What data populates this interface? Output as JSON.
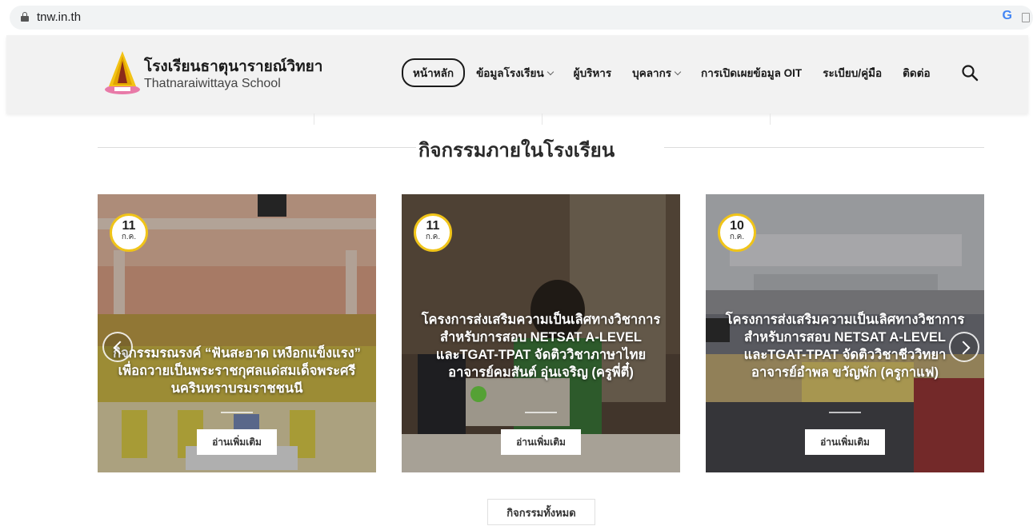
{
  "browser": {
    "url": "tnw.in.th",
    "google_icon": "G"
  },
  "header": {
    "brand_thai": "โรงเรียนธาตุนารายณ์วิทยา",
    "brand_english": "Thatnaraiwittaya School",
    "nav": [
      {
        "label": "หน้าหลัก",
        "active": true,
        "dropdown": false
      },
      {
        "label": "ข้อมูลโรงเรียน",
        "active": false,
        "dropdown": true
      },
      {
        "label": "ผู้บริหาร",
        "active": false,
        "dropdown": false
      },
      {
        "label": "บุคลากร",
        "active": false,
        "dropdown": true
      },
      {
        "label": "การเปิดเผยข้อมูล OIT",
        "active": false,
        "dropdown": false
      },
      {
        "label": "ระเบียบ/คู่มือ",
        "active": false,
        "dropdown": false
      },
      {
        "label": "ติดต่อ",
        "active": false,
        "dropdown": false
      }
    ]
  },
  "section": {
    "title": "กิจกรรมภายในโรงเรียน",
    "all_button": "กิจกรรมทั้งหมด"
  },
  "cards": [
    {
      "day": "11",
      "month": "ก.ค.",
      "title": "กิจกรรมรณรงค์ “ฟันสะอาด เหงือกแข็งแรง” เพื่อถวายเป็นพระราชกุศลแด่สมเด็จพระศรีนครินทราบรมราชชนนี",
      "read_more": "อ่านเพิ่มเติม"
    },
    {
      "day": "11",
      "month": "ก.ค.",
      "title": "โครงการส่งเสริมความเป็นเลิศทางวิชาการ สำหรับการสอบ NETSAT A-LEVEL และTGAT-TPAT จัดติววิชาภาษาไทย อาจารย์คมสันต์ อุ่นเจริญ (ครูพี่ตี๋)",
      "read_more": "อ่านเพิ่มเติม"
    },
    {
      "day": "10",
      "month": "ก.ค.",
      "title": "โครงการส่งเสริมความเป็นเลิศทางวิชาการ สำหรับการสอบ NETSAT A-LEVEL และTGAT-TPAT จัดติววิชาชีววิทยา อาจารย์อำพล ขวัญพัก (ครูกาแฟ)",
      "read_more": "อ่านเพิ่มเติม"
    }
  ],
  "colors": {
    "badge_border": "#f0c419",
    "header_bg": "#f2f2f2"
  }
}
